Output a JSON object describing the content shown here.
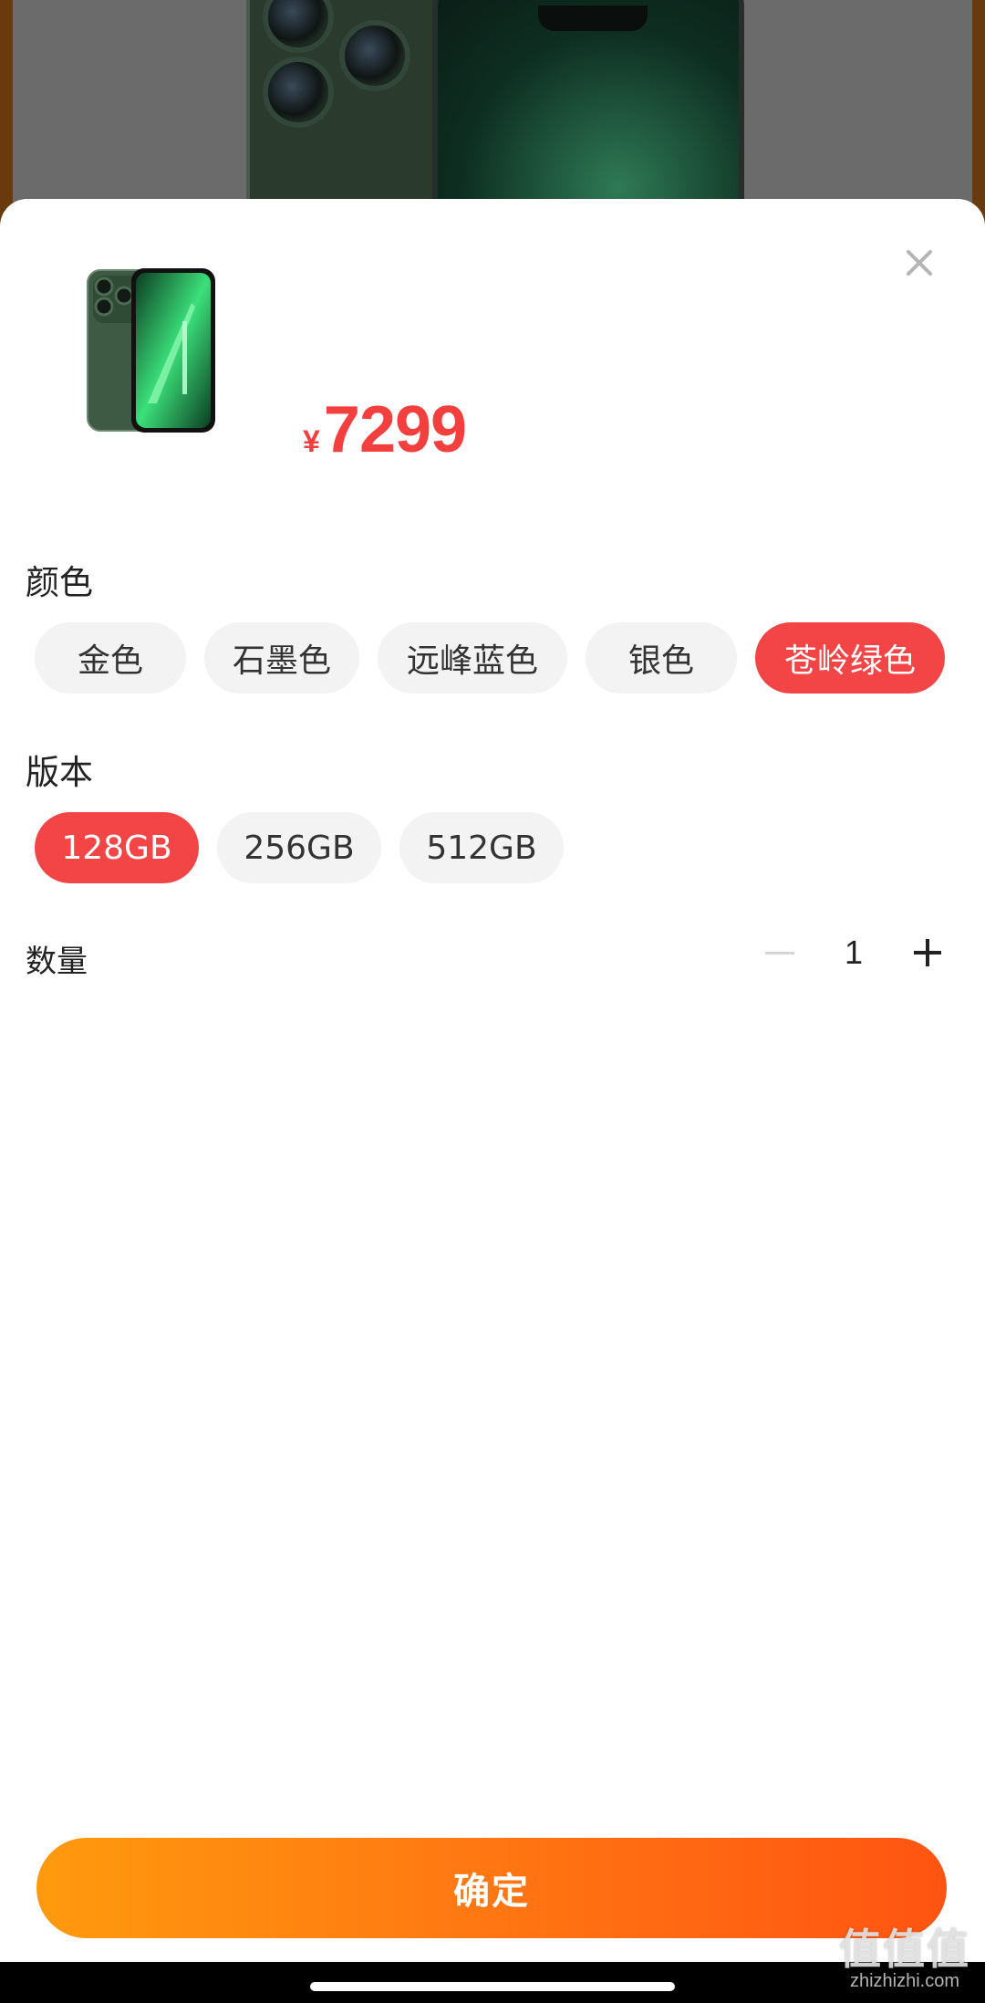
{
  "price": {
    "currency": "¥",
    "amount": "7299"
  },
  "color_section": {
    "title": "颜色",
    "options": [
      "金色",
      "石墨色",
      "远峰蓝色",
      "银色",
      "苍岭绿色"
    ],
    "selected_index": 4
  },
  "version_section": {
    "title": "版本",
    "options": [
      "128GB",
      "256GB",
      "512GB"
    ],
    "selected_index": 0
  },
  "quantity": {
    "label": "数量",
    "value": "1"
  },
  "confirm_label": "确定",
  "watermark": {
    "text": "值值值",
    "url": "zhizhizhi.com"
  },
  "icons": {
    "close": "close-icon",
    "minus": "minus-icon",
    "plus": "plus-icon"
  },
  "colors": {
    "accent": "#f44546",
    "price": "#f43f3f",
    "button_gradient_start": "#ff9a0e",
    "button_gradient_end": "#ff5412"
  }
}
